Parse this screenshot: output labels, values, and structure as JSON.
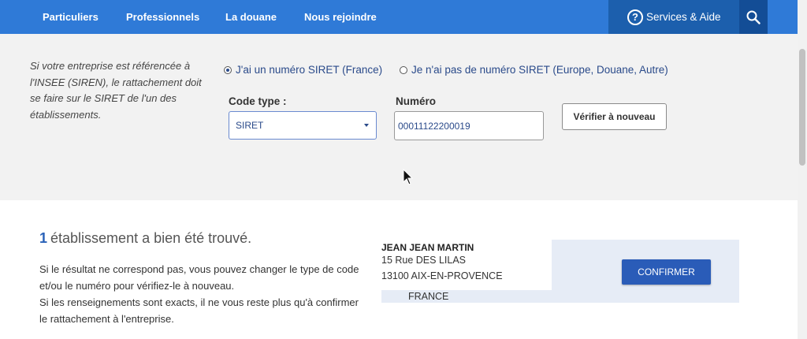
{
  "nav": {
    "items": [
      {
        "label": "Particuliers"
      },
      {
        "label": "Professionnels"
      },
      {
        "label": "La douane"
      },
      {
        "label": "Nous rejoindre"
      }
    ],
    "services_label": "Services & Aide",
    "help_icon_glyph": "?",
    "search_icon": "magnifier-icon"
  },
  "form": {
    "info_text": "Si votre entreprise est référencée à l'INSEE (SIREN), le rattachement doit se faire sur le SIRET de l'un des établissements.",
    "radio_siret": "J'ai un numéro SIRET (France)",
    "radio_no_siret": "Je n'ai pas de numéro SIRET (Europe, Douane, Autre)",
    "code_type_label": "Code type :",
    "code_type_value": "SIRET",
    "numero_label": "Numéro",
    "numero_value": "00011122200019",
    "verify_label": "Vérifier à nouveau"
  },
  "result": {
    "count": "1",
    "title_rest": "établissement a bien été trouvé.",
    "text_line1": "Si le résultat ne correspond pas, vous pouvez changer le type de code",
    "text_line2": "et/ou le numéro pour vérifiez-le à nouveau.",
    "text_line3": "Si les renseignements sont exacts, il ne vous reste plus qu'à confirmer",
    "text_line4": "le rattachement à l'entreprise.",
    "company": {
      "name": "JEAN JEAN MARTIN",
      "address1": "15 Rue DES LILAS",
      "address2": "13100 AIX-EN-PROVENCE",
      "country": "FRANCE"
    },
    "confirm_label": "CONFIRMER"
  },
  "colors": {
    "nav_bg": "#2f7ad7",
    "services_bg": "#1c5fad",
    "search_bg": "#134d96",
    "accent": "#2a62b8",
    "confirm_bg": "#2a5cb8",
    "card_bg": "#e6ecf6",
    "panel_bg": "#f2f2f2"
  }
}
